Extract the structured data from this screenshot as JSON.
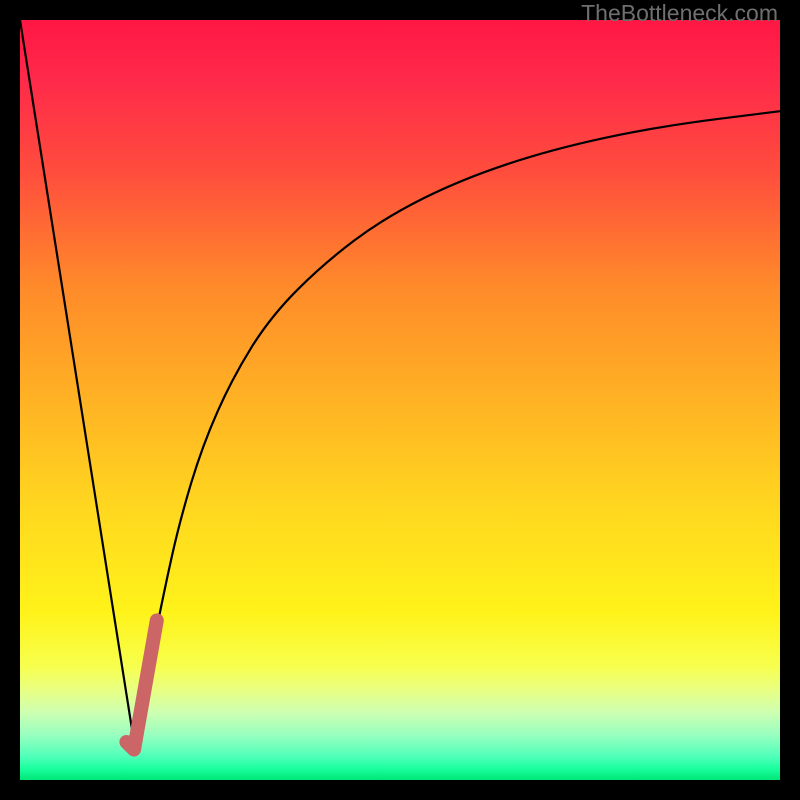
{
  "watermark": "TheBottleneck.com",
  "palette": {
    "black": "#000000",
    "curve_stroke": "#000000",
    "highlight_segment": "#cc6666",
    "gradient_stops": [
      {
        "offset": 0.0,
        "color": "#ff1744"
      },
      {
        "offset": 0.08,
        "color": "#ff2a4a"
      },
      {
        "offset": 0.2,
        "color": "#ff4d3d"
      },
      {
        "offset": 0.35,
        "color": "#ff8a2a"
      },
      {
        "offset": 0.5,
        "color": "#ffb224"
      },
      {
        "offset": 0.65,
        "color": "#ffd91f"
      },
      {
        "offset": 0.78,
        "color": "#fff31a"
      },
      {
        "offset": 0.85,
        "color": "#f7ff4d"
      },
      {
        "offset": 0.88,
        "color": "#eaff80"
      },
      {
        "offset": 0.91,
        "color": "#cfffb0"
      },
      {
        "offset": 0.94,
        "color": "#9affc0"
      },
      {
        "offset": 0.97,
        "color": "#4dffb8"
      },
      {
        "offset": 0.985,
        "color": "#1aff9e"
      },
      {
        "offset": 1.0,
        "color": "#00e676"
      }
    ]
  },
  "chart_data": {
    "type": "line",
    "title": "",
    "xlabel": "",
    "ylabel": "",
    "xlim": [
      0,
      100
    ],
    "ylim": [
      0,
      100
    ],
    "grid": false,
    "legend": false,
    "series": [
      {
        "name": "left-falling-line",
        "x": [
          0,
          15
        ],
        "y": [
          100,
          5
        ]
      },
      {
        "name": "log-rising-curve",
        "x": [
          15,
          17,
          19,
          21,
          24,
          28,
          33,
          40,
          48,
          58,
          70,
          84,
          100
        ],
        "y": [
          5,
          15,
          25,
          34,
          44,
          53,
          61,
          68,
          74,
          79,
          83,
          86,
          88
        ]
      },
      {
        "name": "highlight-segment",
        "x": [
          14,
          15,
          18
        ],
        "y": [
          5,
          4,
          21
        ]
      }
    ],
    "annotations": [
      {
        "text": "TheBottleneck.com",
        "position": "top-right"
      }
    ]
  }
}
